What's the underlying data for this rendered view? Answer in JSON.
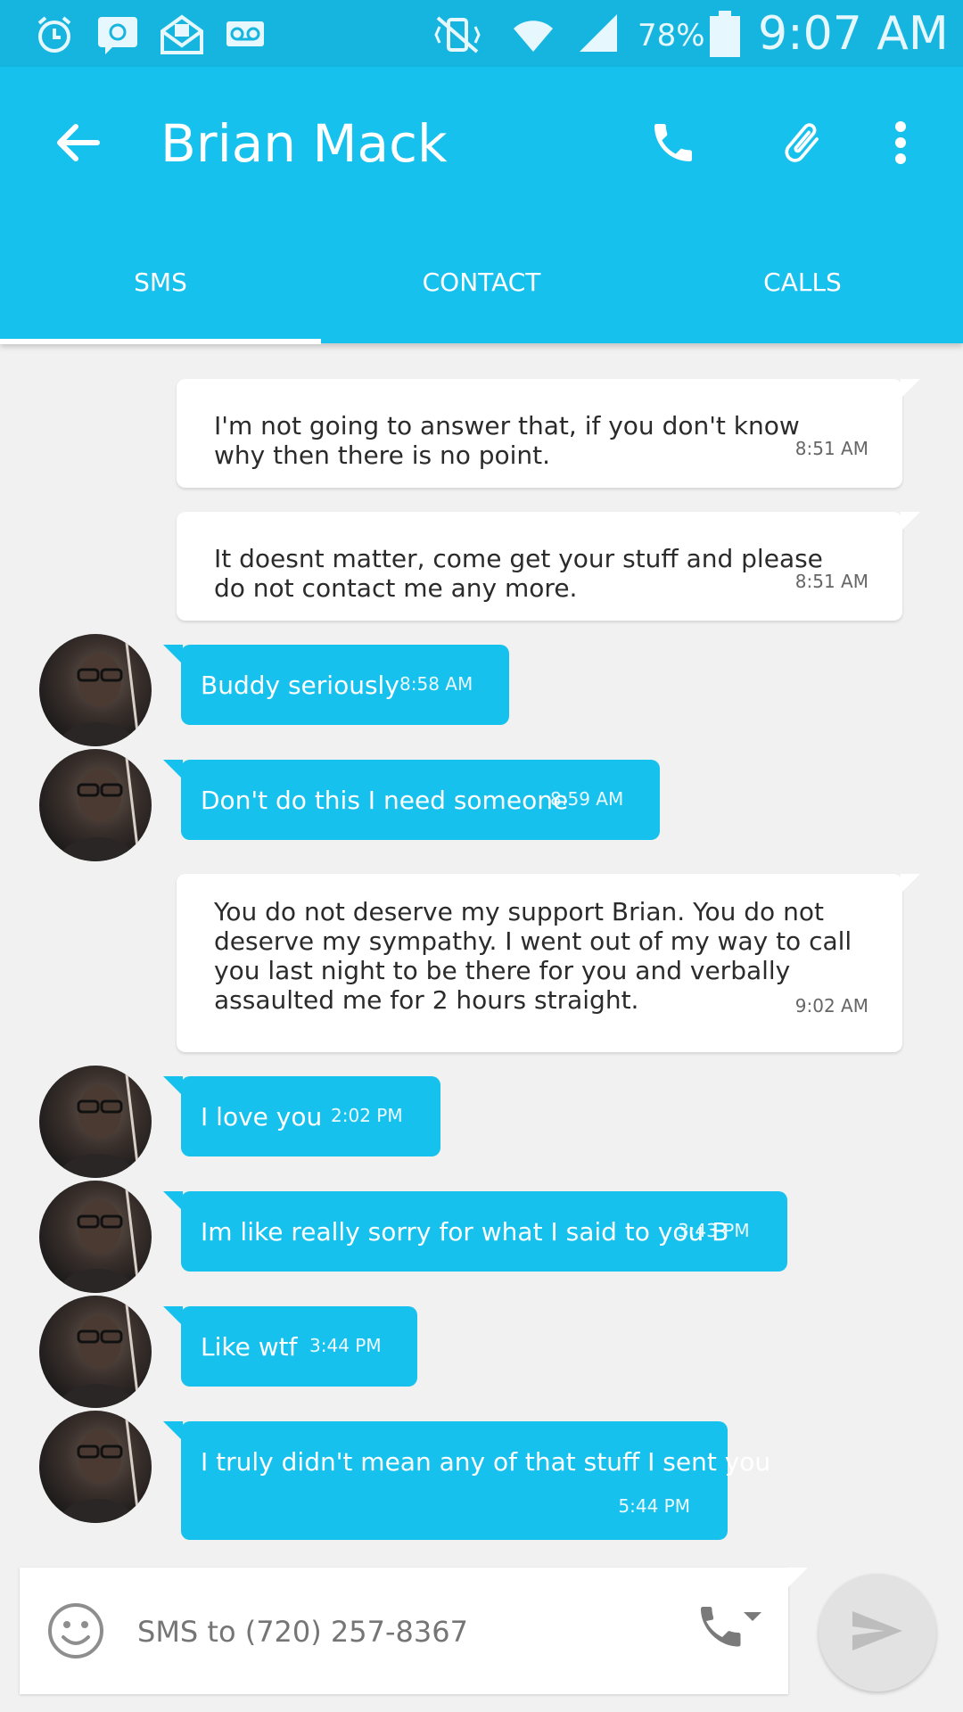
{
  "status_bar": {
    "battery": "78%",
    "time": "9:07 AM"
  },
  "header": {
    "contact_name": "Brian Mack"
  },
  "tabs": [
    "SMS",
    "CONTACT",
    "CALLS"
  ],
  "messages": [
    {
      "direction": "in",
      "text": "I'm not going to answer that, if you don't know why then there is no point.",
      "time": "8:51 AM"
    },
    {
      "direction": "in",
      "text": "It doesnt matter, come get your stuff and please do not contact me any more.",
      "time": "8:51 AM"
    },
    {
      "direction": "out",
      "text": "Buddy seriously",
      "time": "8:58 AM"
    },
    {
      "direction": "out",
      "text": "Don't do this I need someone",
      "time": "8:59 AM"
    },
    {
      "direction": "in",
      "text": "You do not deserve my support Brian. You do not deserve my sympathy. I went out of my way to call you last night to be there for you and verbally assaulted me for 2 hours straight.",
      "time": "9:02 AM"
    },
    {
      "direction": "out",
      "text": "I love you",
      "time": "2:02 PM"
    },
    {
      "direction": "out",
      "text": "Im like really sorry for what I said to you B",
      "time": "3:43 PM"
    },
    {
      "direction": "out",
      "text": "Like wtf",
      "time": "3:44 PM"
    },
    {
      "direction": "out",
      "text": "I truly didn't mean any of that stuff I sent you",
      "time": "5:44 PM"
    }
  ],
  "composer": {
    "placeholder": "SMS to (720) 257-8367"
  },
  "colors": {
    "accent": "#16c1ee",
    "status_bar": "#16b5e0",
    "background": "#f1f1f1"
  }
}
